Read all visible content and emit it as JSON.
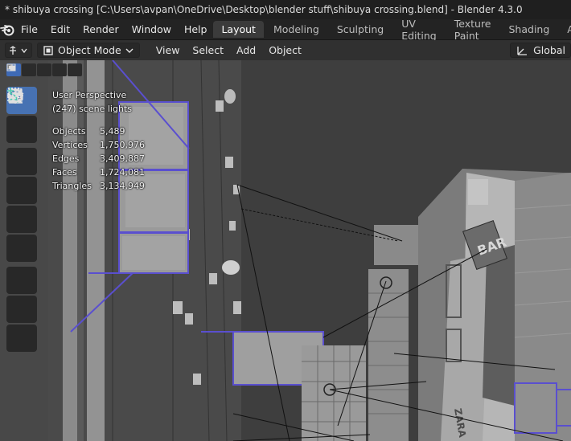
{
  "window": {
    "title": "* shibuya crossing [C:\\Users\\avpan\\OneDrive\\Desktop\\blender stuff\\shibuya crossing.blend] - Blender 4.3.0"
  },
  "menu": {
    "items": [
      "File",
      "Edit",
      "Render",
      "Window",
      "Help"
    ]
  },
  "workspaces": {
    "tabs": [
      "Layout",
      "Modeling",
      "Sculpting",
      "UV Editing",
      "Texture Paint",
      "Shading",
      "Ar"
    ],
    "active": "Layout"
  },
  "header": {
    "mode": "Object Mode",
    "menus": [
      "View",
      "Select",
      "Add",
      "Object"
    ],
    "transform_orientation": "Global"
  },
  "viewport": {
    "view_name": "User Perspective",
    "collection_info": "(247) scene lights",
    "stats": [
      {
        "label": "Objects",
        "value": "5,489"
      },
      {
        "label": "Vertices",
        "value": "1,750,976"
      },
      {
        "label": "Edges",
        "value": "3,409,887"
      },
      {
        "label": "Faces",
        "value": "1,724,081"
      },
      {
        "label": "Triangles",
        "value": "3,134,949"
      }
    ]
  },
  "colors": {
    "accent": "#4772b3",
    "selection_outline": "#5a4fcf",
    "viewport_bg": "#3d3d3d"
  },
  "icons": {
    "tools": [
      "select-box-icon",
      "cursor-icon",
      "move-icon",
      "rotate-icon",
      "scale-icon",
      "transform-icon",
      "annotate-icon",
      "measure-icon",
      "add-cube-icon"
    ]
  },
  "sign_text": {
    "bar": "BAR",
    "zara": "ZARA"
  }
}
